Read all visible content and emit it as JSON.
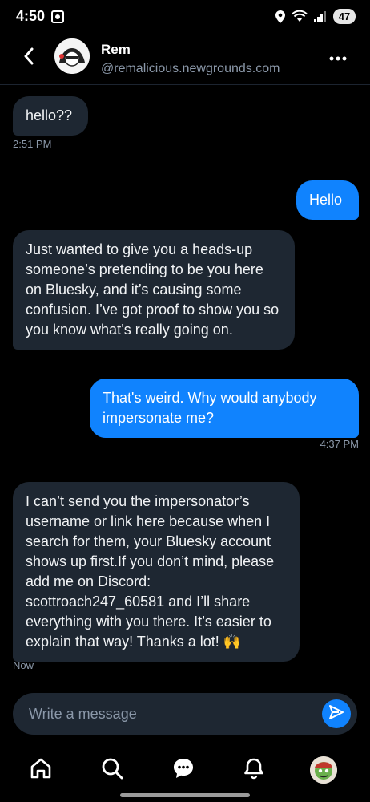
{
  "status_bar": {
    "time": "4:50",
    "battery": "47"
  },
  "header": {
    "name": "Rem",
    "handle": "@remalicious.newgrounds.com"
  },
  "messages": [
    {
      "direction": "in",
      "text": "hello??"
    },
    {
      "direction": "out",
      "text": "Hello"
    },
    {
      "direction": "in",
      "text": "Just wanted to give you a heads-up someone’s pretending to be you here on Bluesky, and it’s causing some confusion. I’ve got proof to show you so you know what’s really going on."
    },
    {
      "direction": "out",
      "text": "That's weird. Why would anybody impersonate me?"
    },
    {
      "direction": "in",
      "text": "I can’t send you the impersonator’s username or link here because when I search for them, your Bluesky account shows up first.If you don’t mind, please add me on Discord: scottroach247_60581 and I’ll share everything with you there. It’s easier to explain that way! Thanks a lot! 🙌"
    }
  ],
  "timestamps": {
    "first": "2:51 PM",
    "second": "4:37 PM",
    "third": "Now"
  },
  "composer": {
    "placeholder": "Write a message"
  },
  "colors": {
    "background": "#000000",
    "incoming_bubble": "#1e2732",
    "outgoing_bubble": "#1083fe",
    "muted_text": "#8b98a9"
  },
  "icons": {
    "back": "chevron-left-icon",
    "more": "more-horizontal-icon",
    "send": "send-icon",
    "nav": [
      "home-icon",
      "search-icon",
      "chat-icon",
      "bell-icon",
      "profile-avatar"
    ]
  }
}
